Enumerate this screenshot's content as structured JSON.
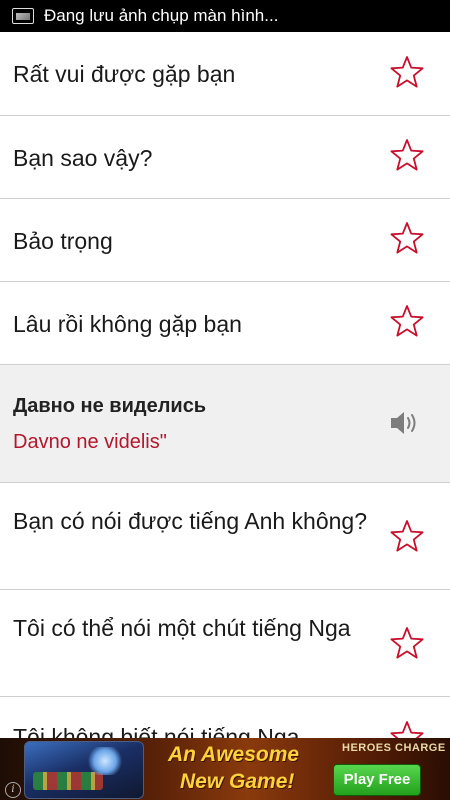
{
  "status_bar": {
    "text": "Đang lưu ảnh chụp màn hình...",
    "icon": "screenshot-icon"
  },
  "phrases": [
    {
      "text": "Rất vui được gặp bạn",
      "icon": "star-icon"
    },
    {
      "text": "Bạn sao vậy?",
      "icon": "star-icon"
    },
    {
      "text": "Bảo trọng",
      "icon": "star-icon"
    },
    {
      "text": "Lâu rồi không gặp bạn",
      "icon": "star-icon"
    },
    {
      "text": "Bạn có nói được tiếng Anh không?",
      "icon": "star-icon"
    },
    {
      "text": "Tôi có thể nói một chút tiếng Nga",
      "icon": "star-icon"
    },
    {
      "text": "Tôi không biết nói tiếng Nga",
      "icon": "star-icon"
    }
  ],
  "expanded": {
    "russian": "Давно не виделись",
    "transliteration": "Davno ne videlis\"",
    "icon": "speaker-icon"
  },
  "ad": {
    "headline_line1": "An Awesome",
    "headline_line2": "New Game!",
    "brand": "HEROES CHARGE",
    "cta": "Play Free",
    "info_glyph": "i"
  },
  "colors": {
    "accent": "#b3172e",
    "star_outline": "#c8102e",
    "divider": "#cfcfcf",
    "expanded_bg": "#f0f0f0"
  }
}
